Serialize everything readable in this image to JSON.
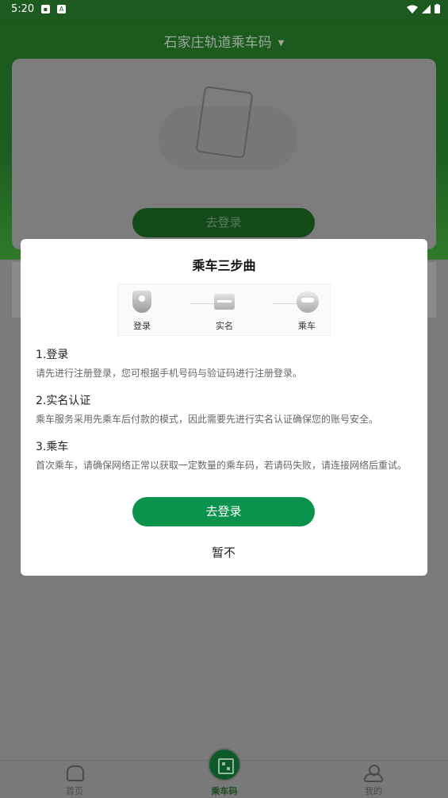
{
  "status_bar": {
    "time": "5:20",
    "icon_a": "A"
  },
  "header": {
    "title": "石家庄轨道乘车码"
  },
  "background": {
    "login_label": "去登录"
  },
  "bottom_nav": {
    "home": "首页",
    "code": "乘车码",
    "me": "我的"
  },
  "dialog": {
    "title": "乘车三步曲",
    "steps": [
      {
        "label": "登录",
        "icon": "shield-user-icon"
      },
      {
        "label": "实名",
        "icon": "id-card-icon"
      },
      {
        "label": "乘车",
        "icon": "train-icon"
      }
    ],
    "sections": [
      {
        "head": "1.登录",
        "body": "请先进行注册登录，您可根据手机号码与验证码进行注册登录。"
      },
      {
        "head": "2.实名认证",
        "body": "乘车服务采用先乘车后付款的模式，因此需要先进行实名认证确保您的账号安全。"
      },
      {
        "head": "3.乘车",
        "body": "首次乘车，请确保网络正常以获取一定数量的乘车码，若请码失败，请连接网络后重试。"
      }
    ],
    "primary_label": "去登录",
    "secondary_label": "暂不"
  },
  "colors": {
    "primary": "#0b934d",
    "header_green": "#1b5e20"
  }
}
